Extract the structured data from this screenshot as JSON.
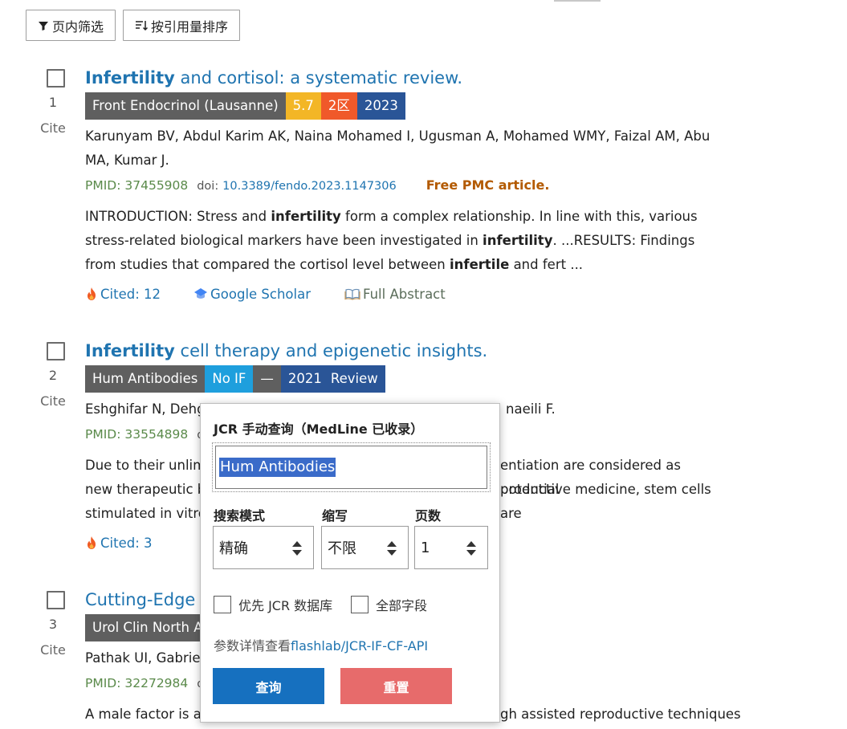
{
  "toolbar": {
    "filter_label": "页内筛选",
    "sort_label": "按引用量排序"
  },
  "results": [
    {
      "index": "1",
      "cite": "Cite",
      "title_bold": "Infertility",
      "title_rest": " and cortisol: a systematic review.",
      "badges": [
        {
          "text": "Front Endocrinol (Lausanne)",
          "color": "#5f5f5f"
        },
        {
          "text": "5.7",
          "color": "#f3b626"
        },
        {
          "text": "2区",
          "color": "#f0592a"
        },
        {
          "text": "2023",
          "color": "#2a5597"
        }
      ],
      "authors": "Karunyam BV, Abdul Karim AK, Naina Mohamed I, Ugusman A, Mohamed WMY, Faizal AM, Abu MA, Kumar J.",
      "pmid": "PMID: 37455908",
      "doi_label": "doi:",
      "doi": "10.3389/fendo.2023.1147306",
      "free_pmc": "Free PMC article.",
      "abstract_parts": [
        "INTRODUCTION: Stress and ",
        "infertility",
        " form a complex relationship. In line with this, various stress-related biological markers have been investigated in ",
        "infertility",
        ". ...RESULTS: Findings from studies that compared the cortisol level between ",
        "infertile",
        " and fert ..."
      ],
      "cited": "Cited: 12",
      "google_scholar": "Google Scholar",
      "full_abstract": "Full Abstract"
    },
    {
      "index": "2",
      "cite": "Cite",
      "title_bold": "Infertility",
      "title_rest": " cell therapy and epigenetic insights.",
      "badges": [
        {
          "text": "Hum Antibodies",
          "color": "#5f5f5f"
        },
        {
          "text": "No IF",
          "color": "#1e9fdd"
        },
        {
          "text": "—",
          "color": "#5f5f5f"
        },
        {
          "text": "2021",
          "color": "#2a5597"
        },
        {
          "text": "Review",
          "color": "#2a5597"
        }
      ],
      "authors_visible": "Eshghifar N, Dehgh",
      "authors_tail": "naeili F.",
      "pmid": "PMID: 33554898",
      "pmid_tail": "d",
      "abstract_line1_left": "Due to their unlimi",
      "abstract_line1_right": "entiation are considered as potential",
      "abstract_line2_left": "new therapeutic bi",
      "abstract_line2_right": "productive medicine, stem cells are",
      "abstract_line3_left": "stimulated in vitro",
      "cited": "Cited: 3"
    },
    {
      "index": "3",
      "cite": "Cite",
      "title_visible": "Cutting-Edge E",
      "badge_visible": "Urol Clin North A",
      "authors_visible": "Pathak UI, Gabriels",
      "pmid": "PMID: 32272984",
      "pmid_tail": "d",
      "abstract_left": "A male factor is a c",
      "abstract_right": "gh assisted reproductive techniques"
    }
  ],
  "popup": {
    "title": "JCR 手动查询（MedLine 已收录）",
    "query_value": "Hum Antibodies",
    "mode_label": "搜索模式",
    "mode_value": "精确",
    "abbr_label": "缩写",
    "abbr_value": "不限",
    "pages_label": "页数",
    "pages_value": "1",
    "prefer_jcr": "优先 JCR 数据库",
    "all_fields": "全部字段",
    "params_prefix": "参数详情查看",
    "params_link": "flashlab/JCR-IF-CF-API",
    "query_btn": "查询",
    "reset_btn": "重置"
  }
}
